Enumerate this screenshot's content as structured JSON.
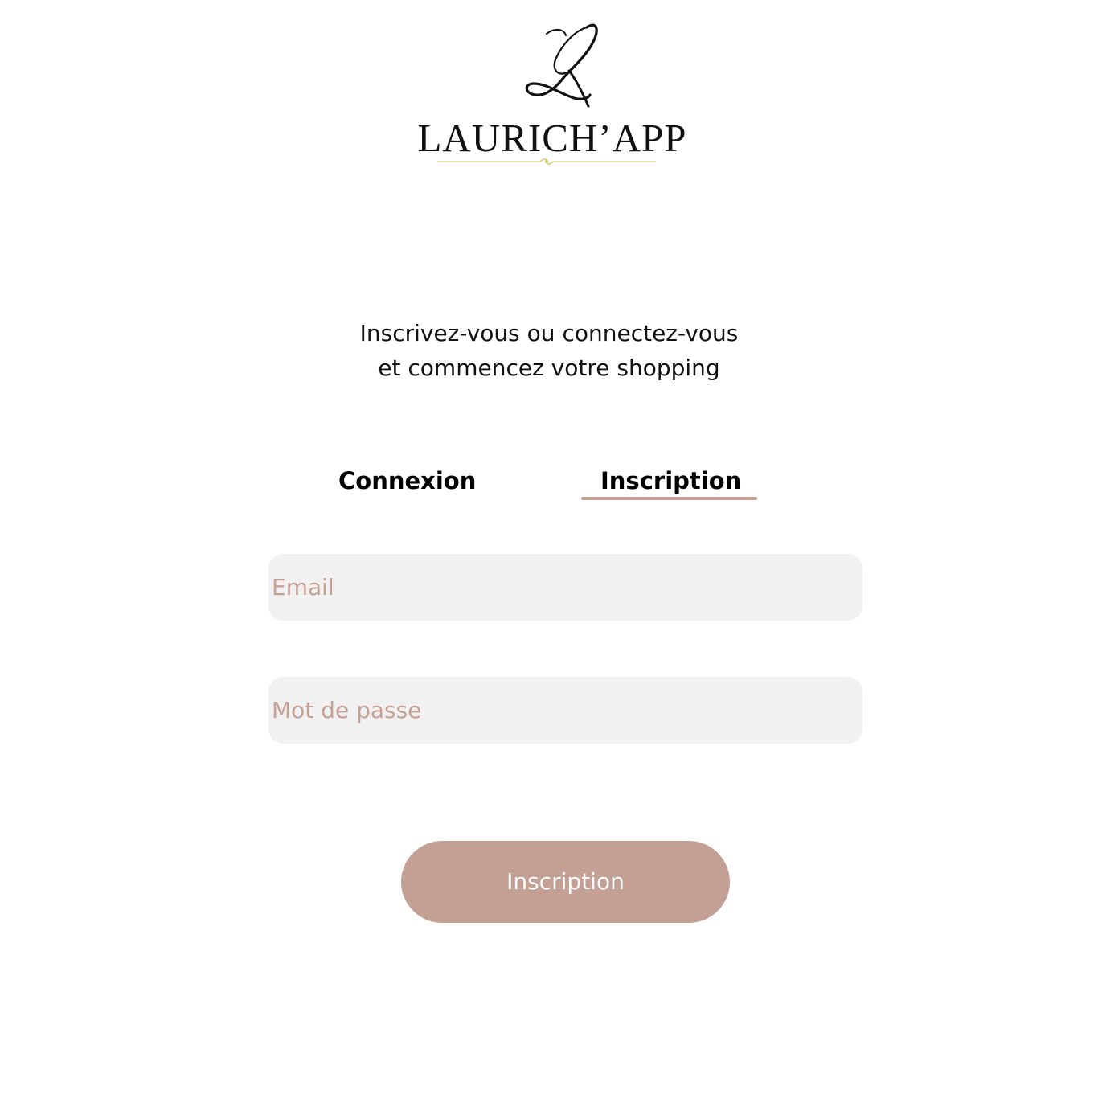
{
  "brand": {
    "name": "LAURICH’APP",
    "logo_icon": "script-L-monogram"
  },
  "tagline": {
    "line1": "Inscrivez-vous ou connectez-vous",
    "line2": "et commencez votre shopping"
  },
  "tabs": [
    {
      "label": "Connexion",
      "active": false
    },
    {
      "label": "Inscription",
      "active": true
    }
  ],
  "form": {
    "email": {
      "placeholder": "Email",
      "value": ""
    },
    "password": {
      "placeholder": "Mot de passe",
      "value": ""
    },
    "submit_label": "Inscription"
  },
  "colors": {
    "accent": "#c4a094",
    "input_background": "#f1f1f1",
    "placeholder": "#c7a094",
    "ornament": "#e3d38a"
  }
}
